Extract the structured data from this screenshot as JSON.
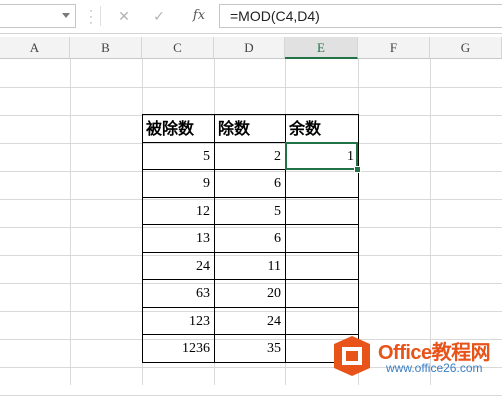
{
  "formula_bar": {
    "name_box_value": "",
    "cancel_icon": "close-icon",
    "enter_icon": "check-icon",
    "fx_label": "fx",
    "formula": "=MOD(C4,D4)"
  },
  "columns": [
    "A",
    "B",
    "C",
    "D",
    "E",
    "F",
    "G"
  ],
  "active_column": "E",
  "table": {
    "headers": [
      "被除数",
      "除数",
      "余数"
    ],
    "rows": [
      [
        "5",
        "2",
        "1"
      ],
      [
        "9",
        "6",
        ""
      ],
      [
        "12",
        "5",
        ""
      ],
      [
        "13",
        "6",
        ""
      ],
      [
        "24",
        "11",
        ""
      ],
      [
        "63",
        "20",
        ""
      ],
      [
        "123",
        "24",
        ""
      ],
      [
        "1236",
        "35",
        ""
      ]
    ]
  },
  "watermark": {
    "line1": "Office教程网",
    "line2": "www.office26.com"
  },
  "colors": {
    "accent": "#217346",
    "watermark_orange": "#e8531a",
    "watermark_blue": "#3a7fc4"
  }
}
